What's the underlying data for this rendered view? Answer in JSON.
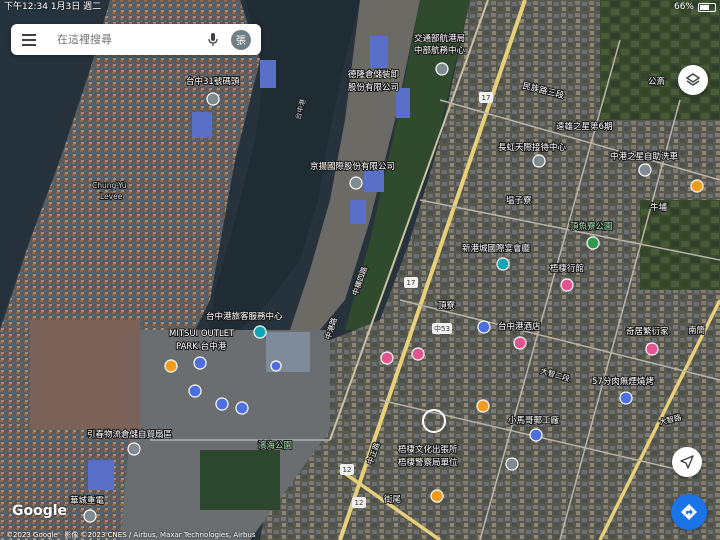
{
  "status": {
    "time": "下午12:34",
    "date": "1月3日 週二",
    "battery": "66%",
    "battery_level": 0.66
  },
  "search": {
    "placeholder": "在這裡搜尋",
    "avatar_initial": "張"
  },
  "map": {
    "logo": "Google",
    "attribution": "©2023 Google · 影像 ©2023 CNES / Airbus, Maxar Technologies, Airbus",
    "labels": [
      "交通部航港局",
      "中部航務中心",
      "德隆倉儲裝卸",
      "股份有限公司",
      "台中31號碼頭",
      "京揚國際股份有限公司",
      "Chung-Yu",
      "Levee",
      "台中港旅客服務中心",
      "MITSUI OUTLET",
      "PARK 台中港",
      "引春物流倉儲自貿扇區",
      "華城重電",
      "民族路三段",
      "遠雄之星第6期",
      "長虹天際接待中心",
      "中港之星自助洗車",
      "公斎",
      "牛埔",
      "塭子寮",
      "頂魚寮公園",
      "新港城國際宴會廳",
      "梧棲行館",
      "中横四路",
      "頂寮",
      "台中港酒店",
      "奇居繁衍家",
      "南簡",
      "57分肉無煙燒烤",
      "小馬哥郵工廠",
      "梧棲文化出張所",
      "梧棲警察局單位",
      "濱海公園",
      "街尾",
      "中港路",
      "大智路",
      "中正路",
      "台中港",
      "大智二段"
    ],
    "road_shields": [
      "17",
      "17",
      "17",
      "中53",
      "12",
      "12"
    ]
  },
  "controls": {
    "layers": "layers-icon",
    "locate": "navigation-arrow-icon",
    "directions": "directions-icon"
  }
}
